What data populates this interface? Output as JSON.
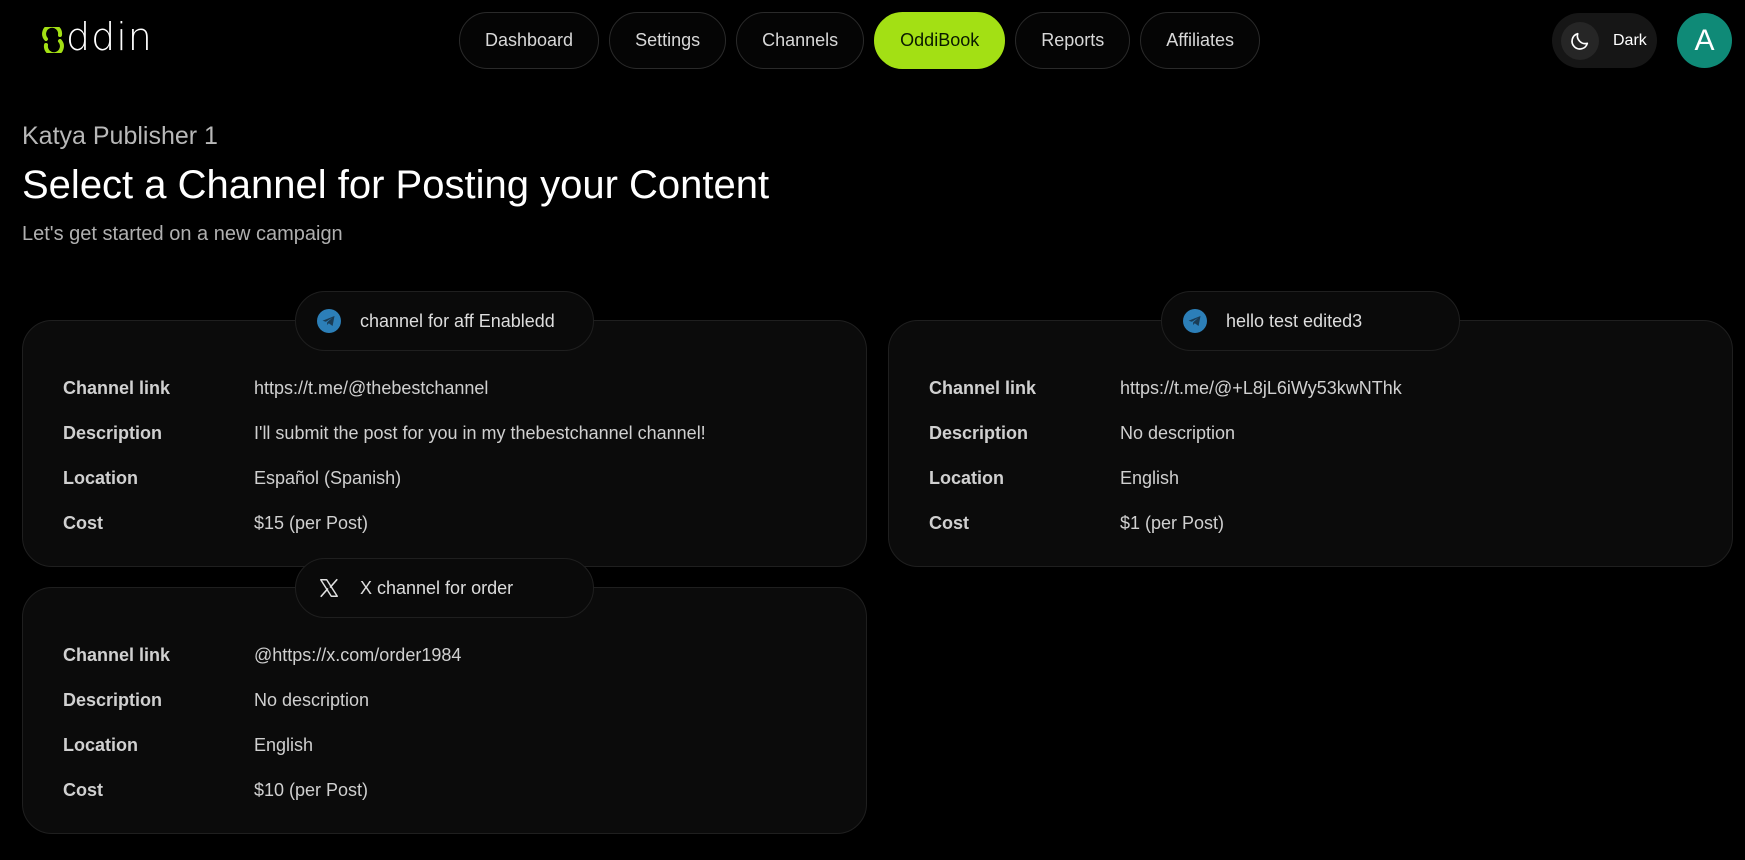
{
  "header": {
    "logo_text": "ddin",
    "nav": [
      {
        "label": "Dashboard",
        "active": false
      },
      {
        "label": "Settings",
        "active": false
      },
      {
        "label": "Channels",
        "active": false
      },
      {
        "label": "OddiBook",
        "active": true
      },
      {
        "label": "Reports",
        "active": false
      },
      {
        "label": "Affiliates",
        "active": false
      }
    ],
    "theme_label": "Dark",
    "avatar_letter": "A"
  },
  "page": {
    "publisher": "Katya Publisher 1",
    "title": "Select a Channel for Posting your Content",
    "subtitle": "Let's get started on a new campaign"
  },
  "labels": {
    "link": "Channel link",
    "description": "Description",
    "location": "Location",
    "cost": "Cost"
  },
  "channels": [
    {
      "name": "channel for aff Enabledd",
      "platform_icon": "telegram-icon",
      "link": "https://t.me/@thebestchannel",
      "description": "I'll submit the post for you in my thebestchannel channel!",
      "location": "Español (Spanish)",
      "cost": "$15 (per Post)"
    },
    {
      "name": "hello test edited3",
      "platform_icon": "telegram-icon",
      "link": "https://t.me/@+L8jL6iWy53kwNThk",
      "description": "No description",
      "location": "English",
      "cost": "$1 (per Post)"
    },
    {
      "name": "X channel for order",
      "platform_icon": "x-icon",
      "link": "@https://x.com/order1984",
      "description": "No description",
      "location": "English",
      "cost": "$10 (per Post)"
    }
  ],
  "colors": {
    "accent": "#a3e014",
    "avatar": "#0f8a77",
    "telegram": "#2c7fb8",
    "background": "#000000"
  }
}
